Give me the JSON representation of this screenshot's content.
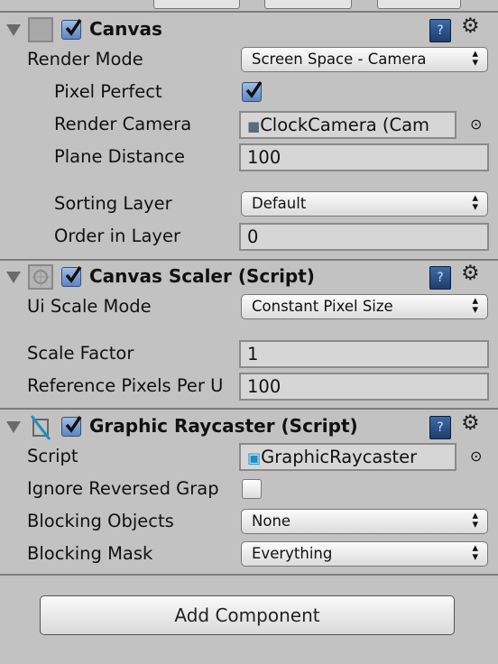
{
  "components": [
    {
      "title": "Canvas",
      "enabled": true,
      "props": {
        "render_mode_label": "Render Mode",
        "render_mode": "Screen Space - Camera",
        "pixel_perfect_label": "Pixel Perfect",
        "pixel_perfect": true,
        "render_camera_label": "Render Camera",
        "render_camera": "ClockCamera (Cam",
        "plane_distance_label": "Plane Distance",
        "plane_distance": "100",
        "sorting_layer_label": "Sorting Layer",
        "sorting_layer": "Default",
        "order_label": "Order in Layer",
        "order": "0"
      }
    },
    {
      "title": "Canvas Scaler (Script)",
      "enabled": true,
      "props": {
        "ui_scale_mode_label": "Ui Scale Mode",
        "ui_scale_mode": "Constant Pixel Size",
        "scale_factor_label": "Scale Factor",
        "scale_factor": "1",
        "ref_ppu_label": "Reference Pixels Per U",
        "ref_ppu": "100"
      }
    },
    {
      "title": "Graphic Raycaster (Script)",
      "enabled": true,
      "props": {
        "script_label": "Script",
        "script": "GraphicRaycaster",
        "ignore_reversed_label": "Ignore Reversed Grap",
        "ignore_reversed": false,
        "blocking_objects_label": "Blocking Objects",
        "blocking_objects": "None",
        "blocking_mask_label": "Blocking Mask",
        "blocking_mask": "Everything"
      }
    }
  ],
  "add_component_label": "Add Component",
  "icons": {
    "help": "?",
    "gear": "⚙",
    "picker": "⊙",
    "arrows": "⬍"
  },
  "colors": {
    "background": "#c2c2c2",
    "checkbox": "#5c86c4"
  }
}
